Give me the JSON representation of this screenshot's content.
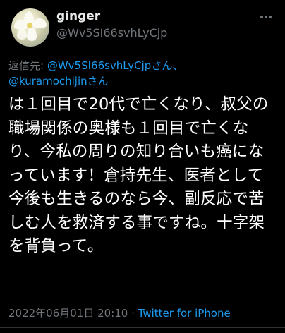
{
  "author": {
    "display_name": "ginger",
    "handle": "@Wv5SI66svhLyCjp"
  },
  "reply": {
    "prefix": "返信先: ",
    "mention1": "@Wv5SI66svhLyCjpさん、",
    "mention2": "@kuramochijinさん"
  },
  "tweet": {
    "text": "は１回目で20代で亡くなり、叔父の職場関係の奥様も１回目で亡くなり、今私の周りの知り合いも癌になっています！倉持先生、医者として今後も生きるのなら今、副反応で苦しむ人を救済する事ですね。十字架を背負って。",
    "timestamp": "2022年06月01日 20:10",
    "separator": " · ",
    "source": "Twitter for iPhone"
  },
  "icons": {
    "avatar": "avatar-flower-image",
    "more": "more-options-icon"
  },
  "colors": {
    "background": "#000000",
    "text": "#ffffff",
    "muted": "#71767b",
    "link": "#1d9bf0"
  }
}
